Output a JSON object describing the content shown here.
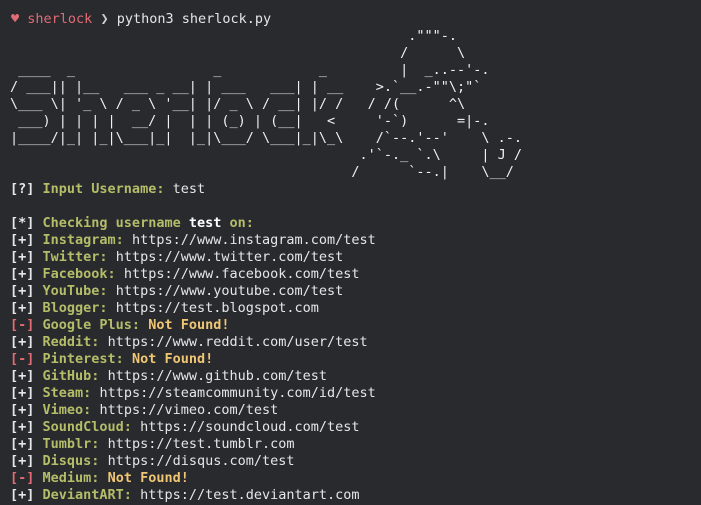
{
  "prompt": {
    "symbol": "♥",
    "user": "sherlock",
    "separator": "❯",
    "command": "python3 sherlock.py"
  },
  "banner_art": "                                                 .\"\"\"-.\n                                                /      \\\n ____  _                 _            _         |  _..--'-.\n/ ___|| |__   ___ _ __| | ___   ___| | __    >.`__.-\"\"\\;\"`\n\\___ \\| '_ \\ / _ \\ '__| |/ _ \\ / __| |/ /   / /(      ^\\\n ___) | | | |  __/ |  | | (_) | (__|   <     '-`)      =|-.\n|____/|_| |_|\\___|_|  |_|\\___/ \\___|_|\\_\\    /`--.'--'    \\ .-.\n                                           .'`-._ `.\\     | J /\n                                          /      `--.|    \\__/",
  "input": {
    "tag": "[?]",
    "label": "Input Username:",
    "value": "test"
  },
  "checking": {
    "tag": "[*]",
    "prefix": "Checking username",
    "username": "test",
    "suffix": "on:"
  },
  "results": [
    {
      "tag": "[+]",
      "site": "Instagram:",
      "text": "https://www.instagram.com/test",
      "found": true
    },
    {
      "tag": "[+]",
      "site": "Twitter:",
      "text": "https://www.twitter.com/test",
      "found": true
    },
    {
      "tag": "[+]",
      "site": "Facebook:",
      "text": "https://www.facebook.com/test",
      "found": true
    },
    {
      "tag": "[+]",
      "site": "YouTube:",
      "text": "https://www.youtube.com/test",
      "found": true
    },
    {
      "tag": "[+]",
      "site": "Blogger:",
      "text": "https://test.blogspot.com",
      "found": true
    },
    {
      "tag": "[-]",
      "site": "Google Plus:",
      "text": "Not Found!",
      "found": false
    },
    {
      "tag": "[+]",
      "site": "Reddit:",
      "text": "https://www.reddit.com/user/test",
      "found": true
    },
    {
      "tag": "[-]",
      "site": "Pinterest:",
      "text": "Not Found!",
      "found": false
    },
    {
      "tag": "[+]",
      "site": "GitHub:",
      "text": "https://www.github.com/test",
      "found": true
    },
    {
      "tag": "[+]",
      "site": "Steam:",
      "text": "https://steamcommunity.com/id/test",
      "found": true
    },
    {
      "tag": "[+]",
      "site": "Vimeo:",
      "text": "https://vimeo.com/test",
      "found": true
    },
    {
      "tag": "[+]",
      "site": "SoundCloud:",
      "text": "https://soundcloud.com/test",
      "found": true
    },
    {
      "tag": "[+]",
      "site": "Tumblr:",
      "text": "https://test.tumblr.com",
      "found": true
    },
    {
      "tag": "[+]",
      "site": "Disqus:",
      "text": "https://disqus.com/test",
      "found": true
    },
    {
      "tag": "[-]",
      "site": "Medium:",
      "text": "Not Found!",
      "found": false
    },
    {
      "tag": "[+]",
      "site": "DeviantART:",
      "text": "https://test.deviantart.com",
      "found": true
    }
  ],
  "colors": {
    "background": "#282a2e",
    "site_label": "#b5bd68",
    "not_found": "#f0c674",
    "prompt_accent": "#e06c75"
  }
}
